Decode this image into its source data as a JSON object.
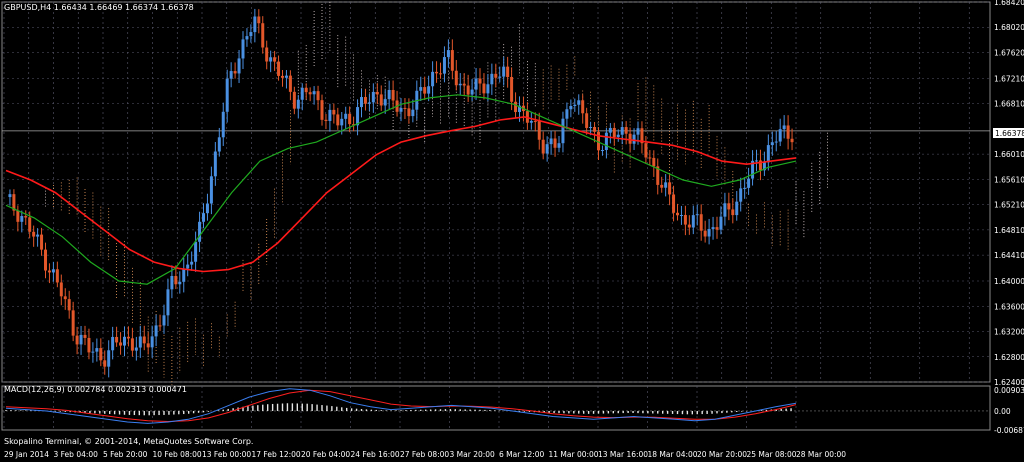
{
  "window": {
    "symbol_line": "GBPUSD,H4  1.66434 1.66469 1.66374 1.66378",
    "macd_line": "MACD(12,26,9) 0.002784 0.002313 0.000471",
    "copyright": "Skopalino Terminal, © 2001-2014, MetaQuotes Software Corp.",
    "current_price": "1.66378"
  },
  "colors": {
    "background": "#000000",
    "grid": "#5a5a6e",
    "bull_candle": "#4a90e2",
    "bear_candle": "#e2572a",
    "ema_red": "#ff1a1a",
    "ema_green": "#1faa1f",
    "cloud_bull": "#f0a060",
    "cloud_bear": "#e8d8d8",
    "macd_hist": "#e6e6e6",
    "macd_signal": "#ff2020",
    "macd_main": "#3a7ef0"
  },
  "chart_data": {
    "type": "candlestick",
    "y_ticks": [
      "1.68420",
      "1.68020",
      "1.67620",
      "1.67210",
      "1.66810",
      "1.66010",
      "1.65610",
      "1.65210",
      "1.64810",
      "1.64410",
      "1.64000",
      "1.63600",
      "1.63200",
      "1.62800",
      "1.62400"
    ],
    "ylim": [
      1.624,
      1.6842
    ],
    "x_ticks": [
      "29 Jan 2014",
      "3 Feb 04:00",
      "5 Feb 20:00",
      "10 Feb 08:00",
      "13 Feb 00:00",
      "17 Feb 12:00",
      "20 Feb 04:00",
      "24 Feb 16:00",
      "27 Feb 08:00",
      "3 Mar 20:00",
      "6 Mar 12:00",
      "11 Mar 00:00",
      "13 Mar 16:00",
      "18 Mar 04:00",
      "20 Mar 20:00",
      "25 Mar 08:00",
      "28 Mar 00:00"
    ],
    "macd_ticks": [
      "0.00903",
      "0.00",
      "-0.006874"
    ],
    "macd_ylim": [
      -0.006874,
      0.00903
    ],
    "close_path": [
      1.6525,
      1.651,
      1.647,
      1.643,
      1.638,
      1.632,
      1.629,
      1.628,
      1.63,
      1.631,
      1.629,
      1.633,
      1.639,
      1.642,
      1.647,
      1.658,
      1.67,
      1.677,
      1.681,
      1.676,
      1.672,
      1.669,
      1.67,
      1.667,
      1.665,
      1.666,
      1.668,
      1.67,
      1.668,
      1.667,
      1.669,
      1.673,
      1.675,
      1.671,
      1.67,
      1.672,
      1.673,
      1.668,
      1.665,
      1.662,
      1.661,
      1.67,
      1.665,
      1.662,
      1.663,
      1.664,
      1.662,
      1.658,
      1.653,
      1.65,
      1.649,
      1.648,
      1.65,
      1.653,
      1.657,
      1.66,
      1.663,
      1.6638
    ],
    "ema_red": [
      1.6575,
      1.656,
      1.654,
      1.651,
      1.648,
      1.645,
      1.643,
      1.642,
      1.6415,
      1.6418,
      1.643,
      1.646,
      1.65,
      1.654,
      1.657,
      1.66,
      1.662,
      1.663,
      1.6638,
      1.6645,
      1.6655,
      1.666,
      1.665,
      1.664,
      1.663,
      1.6625,
      1.662,
      1.6615,
      1.6605,
      1.659,
      1.6585,
      1.659,
      1.6595
    ],
    "ema_green": [
      1.652,
      1.65,
      1.647,
      1.643,
      1.64,
      1.6395,
      1.642,
      1.648,
      1.654,
      1.659,
      1.661,
      1.662,
      1.664,
      1.666,
      1.668,
      1.669,
      1.6695,
      1.669,
      1.668,
      1.666,
      1.664,
      1.662,
      1.66,
      1.658,
      1.656,
      1.655,
      1.656,
      1.658,
      1.659
    ],
    "macd_main": [
      0.001,
      0.0005,
      0.0,
      -0.001,
      -0.002,
      -0.003,
      -0.004,
      -0.0045,
      -0.004,
      -0.003,
      -0.001,
      0.002,
      0.005,
      0.007,
      0.008,
      0.0075,
      0.0055,
      0.003,
      0.0015,
      0.0005,
      0.001,
      0.0015,
      0.002,
      0.0015,
      0.001,
      0.0,
      -0.001,
      -0.002,
      -0.0025,
      -0.003,
      -0.0025,
      -0.002,
      -0.0025,
      -0.003,
      -0.0035,
      -0.003,
      -0.0015,
      0.0,
      0.0015,
      0.0028
    ],
    "macd_signal": [
      0.0015,
      0.0012,
      0.0008,
      0.0002,
      -0.0008,
      -0.0018,
      -0.0028,
      -0.0035,
      -0.0038,
      -0.0035,
      -0.0025,
      -0.0005,
      0.002,
      0.0045,
      0.0065,
      0.0075,
      0.007,
      0.0055,
      0.004,
      0.0025,
      0.0018,
      0.0016,
      0.0018,
      0.0017,
      0.0014,
      0.0008,
      0.0,
      -0.001,
      -0.0017,
      -0.0022,
      -0.0024,
      -0.0022,
      -0.0023,
      -0.0026,
      -0.003,
      -0.003,
      -0.0022,
      -0.001,
      0.0005,
      0.0023
    ]
  }
}
